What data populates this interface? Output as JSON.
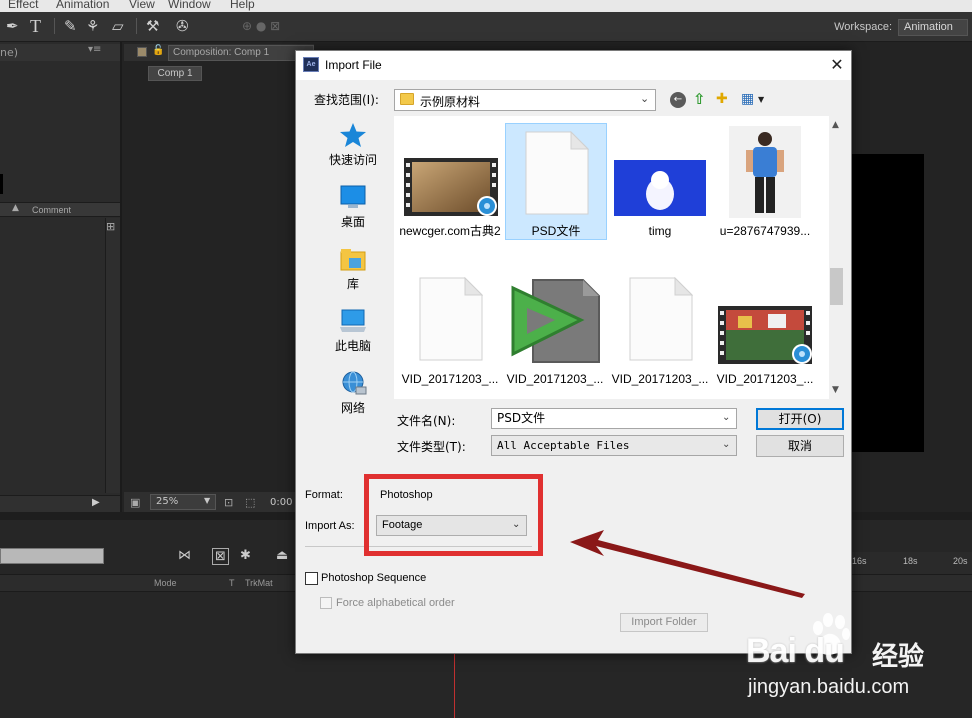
{
  "menubar": {
    "items": [
      "Effect",
      "Animation",
      "View",
      "Window",
      "Help"
    ]
  },
  "workspace": {
    "label": "Workspace:",
    "value": "Animation"
  },
  "project_panel": {
    "tab_fragment": "ne)",
    "comment_column": "Comment"
  },
  "comp_panel": {
    "tab_label": "Composition: Comp 1",
    "subtab": "Comp 1",
    "zoom": "25%",
    "time_fragment": "0:00"
  },
  "timeline": {
    "columns": {
      "mode": "Mode",
      "t": "T",
      "trkmat": "TrkMat"
    },
    "ruler_ticks": [
      "16s",
      "18s",
      "20s"
    ]
  },
  "dialog": {
    "title": "Import File",
    "lookin_label": "查找范围(I):",
    "lookin_value": "示例原材料",
    "places": [
      {
        "label": "快速访问",
        "icon": "star-icon"
      },
      {
        "label": "桌面",
        "icon": "desktop-icon"
      },
      {
        "label": "库",
        "icon": "library-icon"
      },
      {
        "label": "此电脑",
        "icon": "computer-icon"
      },
      {
        "label": "网络",
        "icon": "network-icon"
      }
    ],
    "files": [
      {
        "label": "newcger.com古典2",
        "type": "video",
        "selected": false
      },
      {
        "label": "PSD文件",
        "type": "document",
        "selected": true
      },
      {
        "label": "timg",
        "type": "image",
        "selected": false
      },
      {
        "label": "u=2876747939...",
        "type": "image",
        "selected": false
      },
      {
        "label": "VID_20171203_...",
        "type": "document",
        "selected": false
      },
      {
        "label": "VID_20171203_...",
        "type": "player",
        "selected": false
      },
      {
        "label": "VID_20171203_...",
        "type": "document",
        "selected": false
      },
      {
        "label": "VID_20171203_...",
        "type": "video",
        "selected": false
      }
    ],
    "filename_label": "文件名(N):",
    "filename_value": "PSD文件",
    "filetype_label": "文件类型(T):",
    "filetype_value": "All Acceptable Files",
    "open_button": "打开(O)",
    "cancel_button": "取消",
    "format_label": "Format:",
    "format_value": "Photoshop",
    "import_as_label": "Import As:",
    "import_as_value": "Footage",
    "psd_sequence_label": "Photoshop Sequence",
    "psd_sequence_checked": false,
    "alpha_order_label": "Force alphabetical order",
    "alpha_order_checked": false,
    "import_folder_button": "Import Folder"
  },
  "watermark": {
    "logo": "Bai  du",
    "cn": "经验",
    "url": "jingyan.baidu.com"
  },
  "colors": {
    "highlight_box": "#e03030",
    "arrow": "#8a1818",
    "selection": "#cce8ff",
    "default_button_border": "#0078d7"
  }
}
